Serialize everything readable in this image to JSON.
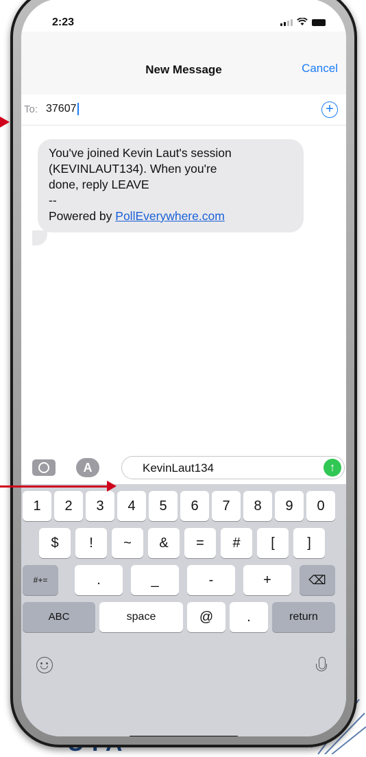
{
  "status": {
    "time": "2:23"
  },
  "nav": {
    "title": "New Message",
    "cancel": "Cancel"
  },
  "to_field": {
    "label": "To:",
    "value": "37607"
  },
  "message": {
    "line1": "You've joined Kevin Laut's session",
    "line2": "(KEVINLAUT134). When you're",
    "line3": "done, reply LEAVE",
    "line4": "--",
    "powered_prefix": "Powered by ",
    "link": "PollEverywhere.com"
  },
  "compose": {
    "input_value": "KevinLaut134",
    "send_icon": "arrow-up-icon"
  },
  "keyboard": {
    "row1": [
      "1",
      "2",
      "3",
      "4",
      "5",
      "6",
      "7",
      "8",
      "9",
      "0"
    ],
    "row2": [
      "$",
      "!",
      "~",
      "&",
      "=",
      "#",
      "[",
      "]"
    ],
    "row3": {
      "shift": "#+=",
      "keys": [
        ".",
        "_",
        "-",
        "+"
      ],
      "delete": "⌫"
    },
    "row4": {
      "abc": "ABC",
      "space": "space",
      "at": "@",
      "dot": ".",
      "return": "return"
    }
  },
  "background_text": "U FA",
  "colors": {
    "accent": "#1a7cf5",
    "send": "#31c754",
    "arrow": "#d0021b"
  }
}
